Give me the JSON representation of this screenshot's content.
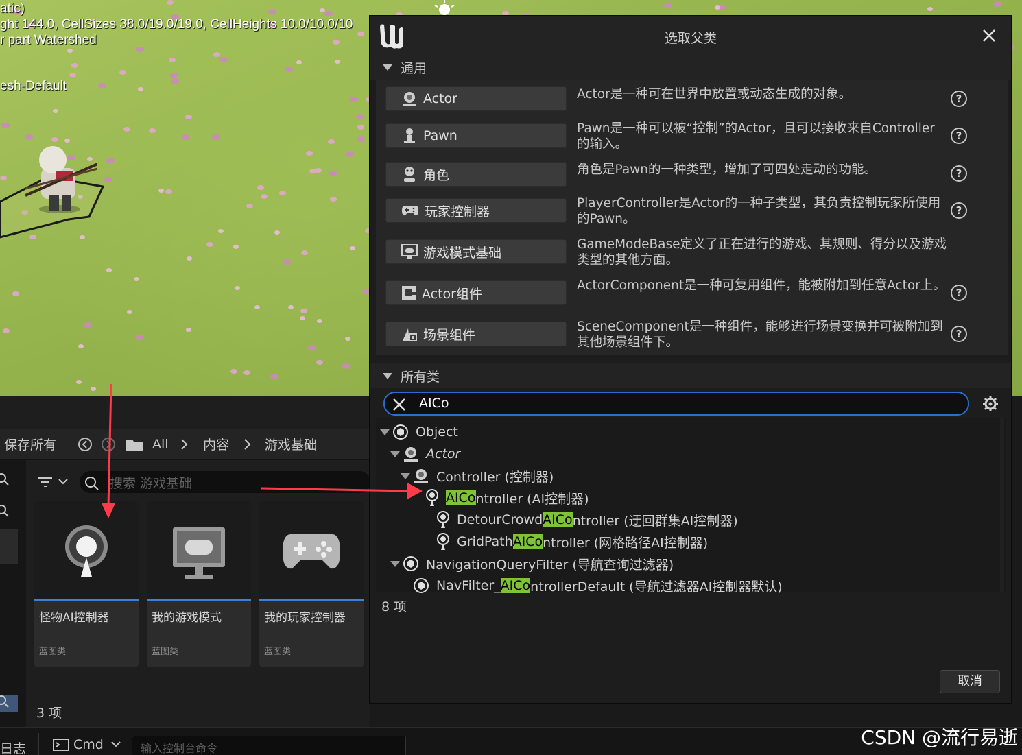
{
  "viewport": {
    "debug_lines": [
      "atic)",
      "ght 144.0, CellSizes 38.0/19.0/19.0, CellHeights 10.0/10.0/10",
      "r part Watershed",
      "esh-Default"
    ]
  },
  "content_browser": {
    "save_all": "保存所有",
    "breadcrumb": [
      "All",
      "内容",
      "游戏基础"
    ],
    "search_placeholder": "搜索 游戏基础",
    "assets": [
      {
        "name": "怪物AI控制器",
        "type": "蓝图类",
        "icon": "ai-controller-icon"
      },
      {
        "name": "我的游戏模式",
        "type": "蓝图类",
        "icon": "game-mode-icon"
      },
      {
        "name": "我的玩家控制器",
        "type": "蓝图类",
        "icon": "gamepad-icon"
      }
    ],
    "count": "3 项"
  },
  "status_bar": {
    "log": "日志",
    "cmd": "Cmd",
    "console_placeholder": "输入控制台命令"
  },
  "watermark": "CSDN @流行易逝",
  "dialog": {
    "title": "选取父类",
    "common_section": "通用",
    "common_classes": [
      {
        "label": "Actor",
        "icon": "actor-icon",
        "desc": "Actor是一种可在世界中放置或动态生成的对象。",
        "help": "?"
      },
      {
        "label": "Pawn",
        "icon": "pawn-icon",
        "desc": "Pawn是一种可以被“控制”的Actor，且可以接收来自Controller的输入。",
        "help": "?"
      },
      {
        "label": "角色",
        "icon": "character-icon",
        "desc": "角色是Pawn的一种类型，增加了可四处走动的功能。",
        "help": "?"
      },
      {
        "label": "玩家控制器",
        "icon": "gamepad-icon",
        "desc": "PlayerController是Actor的一种子类型，其负责控制玩家所使用的Pawn。",
        "help": "?"
      },
      {
        "label": "游戏模式基础",
        "icon": "game-mode-icon",
        "desc": "GameModeBase定义了正在进行的游戏、其规则、得分以及游戏类型的其他方面。",
        "help": ""
      },
      {
        "label": "Actor组件",
        "icon": "actor-component-icon",
        "desc": "ActorComponent是一种可复用组件，能被附加到任意Actor上。",
        "help": "?"
      },
      {
        "label": "场景组件",
        "icon": "scene-component-icon",
        "desc": "SceneComponent是一种组件，能够进行场景变换并可被附加到其他场景组件下。",
        "help": "?"
      }
    ],
    "all_section": "所有类",
    "search_value": "AICo",
    "tree": [
      {
        "pre": "Object",
        "hl": "",
        "post": ""
      },
      {
        "pre": "Actor",
        "hl": "",
        "post": ""
      },
      {
        "pre": "Controller (控制器)",
        "hl": "",
        "post": ""
      },
      {
        "pre": "",
        "hl": "AICo",
        "post": "ntroller (AI控制器)"
      },
      {
        "pre": "DetourCrowd",
        "hl": "AICo",
        "post": "ntroller (迂回群集AI控制器)"
      },
      {
        "pre": "GridPath",
        "hl": "AICo",
        "post": "ntroller (网格路径AI控制器)"
      },
      {
        "pre": "NavigationQueryFilter (导航查询过滤器)",
        "hl": "",
        "post": ""
      },
      {
        "pre": "NavFilter_",
        "hl": "AICo",
        "post": "ntrollerDefault (导航过滤器AI控制器默认)"
      }
    ],
    "count": "8 项",
    "cancel": "取消"
  },
  "colors": {
    "highlight": "#7ec238",
    "accent_blue": "#2a6fcf",
    "arrow_red": "#ff3b4a"
  }
}
